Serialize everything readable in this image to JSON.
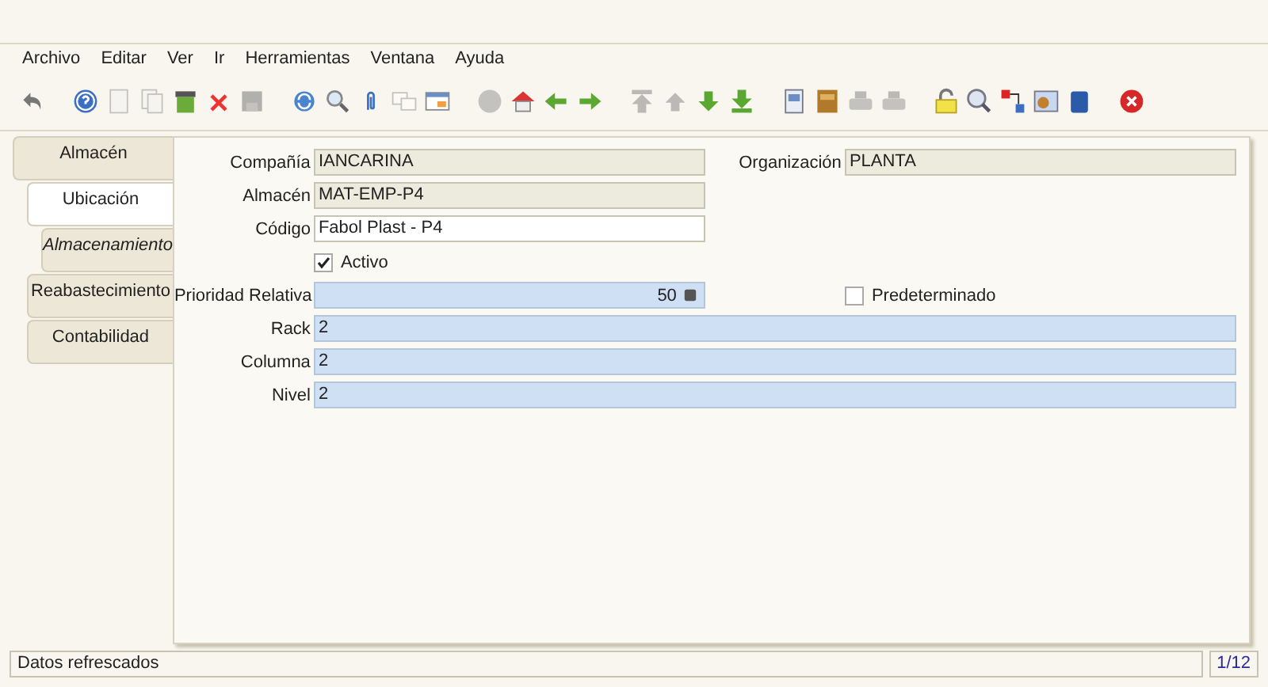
{
  "menu": [
    "Archivo",
    "Editar",
    "Ver",
    "Ir",
    "Herramientas",
    "Ventana",
    "Ayuda"
  ],
  "tabs": [
    {
      "label": "Almacén",
      "selected": false,
      "children": [
        {
          "label": "Ubicación",
          "selected": true,
          "children": [
            {
              "label": "Almacenamiento",
              "selected": false
            }
          ]
        },
        {
          "label": "Reabastecimiento",
          "selected": false
        },
        {
          "label": "Contabilidad",
          "selected": false
        }
      ]
    }
  ],
  "form": [
    {
      "kind": "readonly",
      "label": "Compañía",
      "value": "IANCARINA",
      "right": {
        "kind": "readonly",
        "label": "Organización",
        "value": "PLANTA"
      }
    },
    {
      "kind": "readonly",
      "label": "Almacén",
      "value": "MAT-EMP-P4"
    },
    {
      "kind": "text",
      "label": "Código",
      "value": "Fabol Plast - P4"
    },
    {
      "kind": "checkbox",
      "label": "Activo",
      "checked": true
    },
    {
      "kind": "number",
      "label": "Prioridad Relativa",
      "value": "50",
      "right": {
        "kind": "checkbox",
        "label": "Predeterminado",
        "checked": false
      }
    },
    {
      "kind": "wide",
      "label": "Rack",
      "value": "2"
    },
    {
      "kind": "wide",
      "label": "Columna",
      "value": "2"
    },
    {
      "kind": "wide",
      "label": "Nivel",
      "value": "2"
    }
  ],
  "status_bar": {
    "message": "Datos refrescados",
    "record": "1/12"
  }
}
